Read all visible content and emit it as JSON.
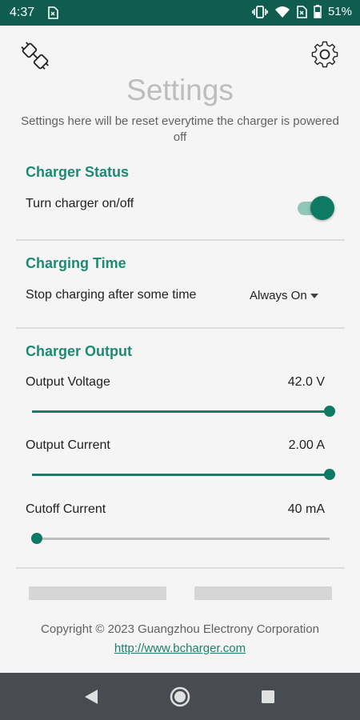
{
  "status_bar": {
    "time": "4:37",
    "battery_percent": "51%",
    "icons": [
      "sim-card-icon",
      "vibrate-icon",
      "wifi-icon",
      "no-sim-icon",
      "battery-icon"
    ]
  },
  "header": {
    "left_icon": "plug-icon",
    "right_icon": "gear-icon",
    "title": "Settings",
    "subtitle": "Settings here will be reset everytime the charger is powered off"
  },
  "charger_status": {
    "title": "Charger Status",
    "toggle_label": "Turn charger on/off",
    "toggle_on": true
  },
  "charging_time": {
    "title": "Charging Time",
    "label": "Stop charging after some time",
    "selected": "Always On"
  },
  "charger_output": {
    "title": "Charger Output",
    "voltage": {
      "label": "Output Voltage",
      "value": "42.0 V",
      "fraction": 1.0
    },
    "current": {
      "label": "Output Current",
      "value": "2.00 A",
      "fraction": 1.0
    },
    "cutoff": {
      "label": "Cutoff Current",
      "value": "40 mA",
      "fraction": 0.0
    }
  },
  "footer": {
    "copyright": "Copyright © 2023 Guangzhou Electrony Corporation",
    "link": "http://www.bcharger.com"
  },
  "colors": {
    "status_bar": "#0e5d4e",
    "accent": "#1e8a74",
    "nav_bar": "#484b4f"
  },
  "nav_bar": {
    "icons": [
      "back-icon",
      "home-icon",
      "recents-icon"
    ]
  }
}
